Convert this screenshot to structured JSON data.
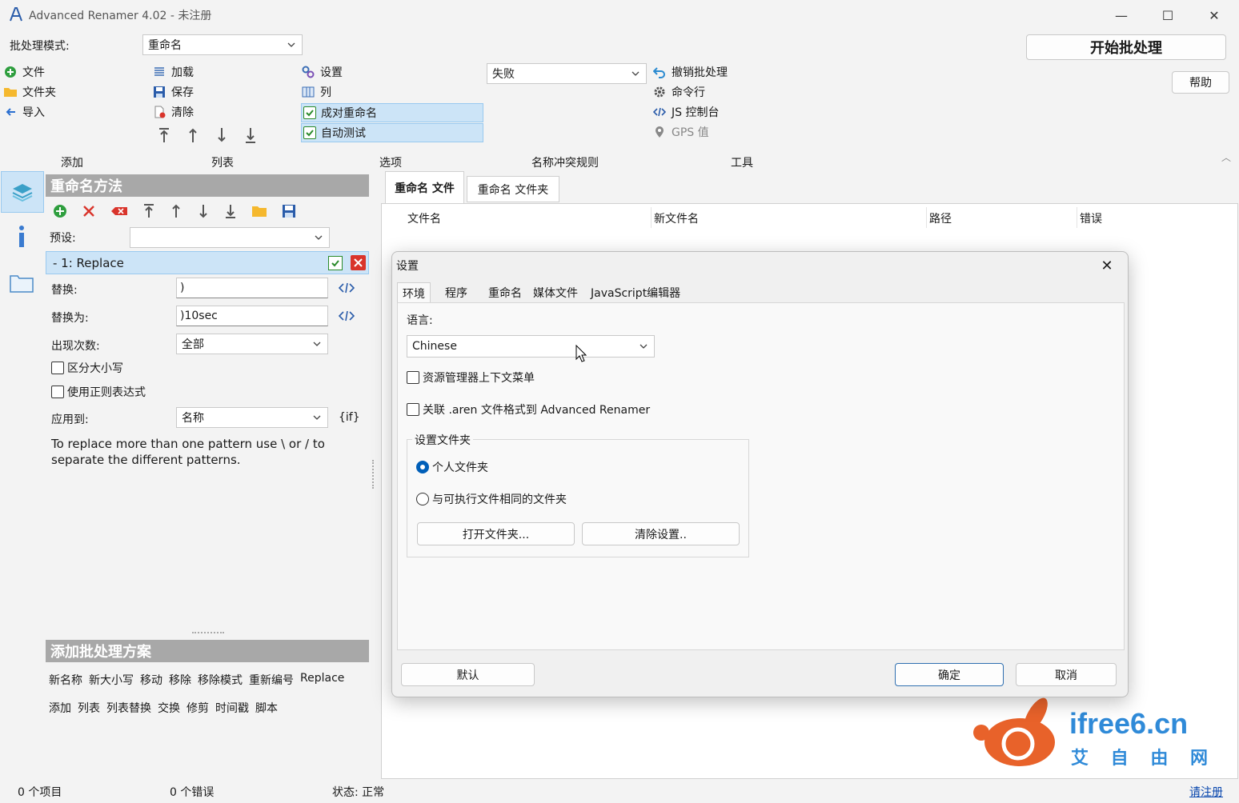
{
  "window": {
    "title": "Advanced Renamer 4.02 - 未注册",
    "minimize": "—",
    "maximize": "☐",
    "close": "✕"
  },
  "toolbar": {
    "batch_mode_label": "批处理模式:",
    "batch_mode_value": "重命名",
    "start_batch": "开始批处理",
    "help": "帮助",
    "add_group": {
      "title": "添加",
      "items": [
        "文件",
        "文件夹",
        "导入"
      ]
    },
    "list_group": {
      "title": "列表",
      "items": [
        "加载",
        "保存",
        "清除"
      ]
    },
    "options_group": {
      "title": "选项",
      "items": [
        "设置",
        "列",
        "成对重命名",
        "自动测试"
      ]
    },
    "conflict_group": {
      "title": "名称冲突规则",
      "value": "失败"
    },
    "tools_group": {
      "title": "工具",
      "items": [
        "撤销批处理",
        "命令行",
        "JS 控制台",
        "GPS 值"
      ]
    }
  },
  "methods_panel": {
    "title": "重命名方法",
    "preset_label": "预设:",
    "preset_value": "",
    "method_row": "-  1: Replace",
    "replace_label": "替换:",
    "replace_value": ")",
    "replace_with_label": "替换为:",
    "replace_with_value": ")10sec",
    "occurrence_label": "出现次数:",
    "occurrence_value": "全部",
    "case_sensitive": "区分大小写",
    "use_regex": "使用正则表达式",
    "apply_to_label": "应用到:",
    "apply_to_value": "名称",
    "if_token": "{if}",
    "hint": "To replace more than one pattern use \\ or / to separate the different patterns."
  },
  "add_method_panel": {
    "title": "添加批处理方案",
    "row1": [
      "新名称",
      "新大小写",
      "移动",
      "移除",
      "移除模式",
      "重新编号",
      "Replace"
    ],
    "row2": [
      "添加",
      "列表",
      "列表替换",
      "交换",
      "修剪",
      "时间戳",
      "脚本"
    ]
  },
  "file_tabs": [
    "重命名 文件",
    "重命名 文件夹"
  ],
  "columns": [
    "文件名",
    "新文件名",
    "路径",
    "错误"
  ],
  "dialog": {
    "title": "设置",
    "tabs": [
      "环境",
      "程序",
      "重命名",
      "媒体文件",
      "JavaScript编辑器"
    ],
    "language_label": "语言:",
    "language_value": "Chinese",
    "explorer_menu": "资源管理器上下文菜单",
    "associate": "关联 .aren 文件格式到 Advanced Renamer",
    "folder_group": "设置文件夹",
    "radio_personal": "个人文件夹",
    "radio_exe": "与可执行文件相同的文件夹",
    "open_folder": "打开文件夹...",
    "clear_settings": "清除设置..",
    "default": "默认",
    "ok": "确定",
    "cancel": "取消"
  },
  "watermark": {
    "domain": "ifree6.cn",
    "tagline": "艾 自 由 网"
  },
  "status": {
    "items": "0  个项目",
    "errors": "0  个错误",
    "state": "状态: 正常",
    "register": "请注册"
  }
}
